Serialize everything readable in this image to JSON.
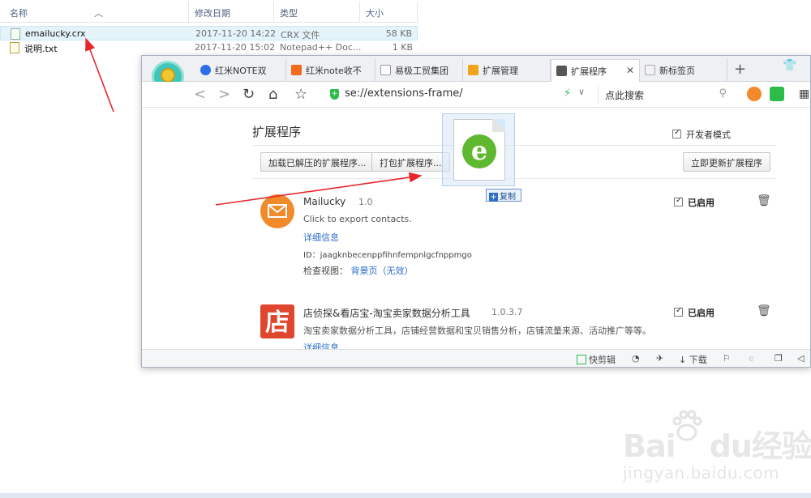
{
  "explorer": {
    "columns": {
      "name": "名称",
      "modified": "修改日期",
      "type": "类型",
      "size": "大小"
    },
    "files": [
      {
        "name": "emailucky.crx",
        "modified": "2017-11-20 14:22",
        "type": "CRX 文件",
        "size": "58 KB"
      },
      {
        "name": "说明.txt",
        "modified": "2017-11-20 15:02",
        "type": "Notepad++ Doc...",
        "size": "1 KB"
      }
    ]
  },
  "browser": {
    "tabs": [
      {
        "label": "红米NOTE双",
        "icon": "baidu-paw-icon",
        "color": "#2d6ee8"
      },
      {
        "label": "红米note收不",
        "icon": "mi-icon",
        "color": "#f26a1b"
      },
      {
        "label": "易极工贸集团",
        "icon": "page-icon",
        "color": "#999999"
      },
      {
        "label": "扩展管理",
        "icon": "grid-apps-icon",
        "color": "#f2a31b"
      },
      {
        "label": "扩展程序",
        "icon": "puzzle-icon",
        "color": "#555555",
        "active": true
      },
      {
        "label": "新标签页",
        "icon": "grid-icon",
        "color": "#aaaaaa"
      }
    ],
    "toolbar": {
      "url": "se://extensions-frame/",
      "search_placeholder": "点此搜索"
    },
    "page": {
      "title": "扩展程序",
      "developer_mode_label": "开发者模式",
      "developer_mode_checked": true,
      "buttons": {
        "load_unpacked": "加载已解压的扩展程序...",
        "pack": "打包扩展程序...",
        "update_now": "立即更新扩展程序"
      },
      "extensions": [
        {
          "name": "Mailucky",
          "version": "1.0",
          "description": "Click to export contacts.",
          "details_link": "详细信息",
          "id_label": "ID：",
          "id": "jaagknbecenppfihnfempnlgcfnppmgo",
          "inspect_label": "检查视图：",
          "inspect_link": "背景页（无效）",
          "enabled_label": "已启用",
          "enabled": true,
          "icon_color": "#f08a2a"
        },
        {
          "name": "店侦探&看店宝-淘宝卖家数据分析工具",
          "version": "1.0.3.7",
          "description": "淘宝卖家数据分析工具，店铺经营数据和宝贝销售分析，店铺流量来源、活动推广等等。",
          "details_link": "详细信息",
          "enabled_label": "已启用",
          "enabled": true,
          "icon_text": "店",
          "icon_color": "#e0452d"
        }
      ]
    },
    "statusbar": {
      "quick_clip": "快剪辑",
      "download": "下载"
    }
  },
  "drag": {
    "copy_label": "复制"
  },
  "watermark": {
    "brand": "Bai",
    "brand2": "经验",
    "domain": "jingyan.baidu.com"
  },
  "colors": {
    "annotation_arrow": "#e8272b",
    "link": "#2a6dc9",
    "accent_green": "#2dbb4a"
  }
}
